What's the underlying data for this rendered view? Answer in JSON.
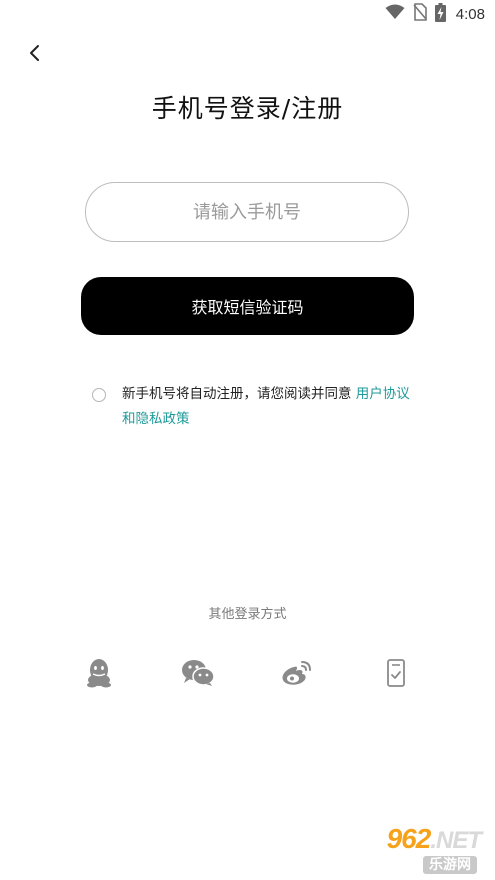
{
  "status_bar": {
    "time": "4:08",
    "icons": [
      "wifi-icon",
      "no-sim-icon",
      "battery-charging-icon"
    ]
  },
  "nav": {
    "back_icon": "chevron-left-icon"
  },
  "page": {
    "title": "手机号登录/注册"
  },
  "form": {
    "phone_placeholder": "请输入手机号",
    "phone_value": "",
    "sms_button_label": "获取短信验证码"
  },
  "agreement": {
    "checked": false,
    "text": "新手机号将自动注册，请您阅读并同意",
    "link_text": "用户协议和隐私政策",
    "link_color": "#1f9a9a"
  },
  "other_login": {
    "label": "其他登录方式",
    "options": [
      {
        "icon": "qq-icon"
      },
      {
        "icon": "wechat-icon"
      },
      {
        "icon": "weibo-icon"
      },
      {
        "icon": "phone-verify-icon"
      }
    ]
  },
  "watermark": {
    "number": "962",
    "suffix": ".NET",
    "tagline": "乐游网"
  },
  "colors": {
    "accent_link": "#1f9a9a",
    "primary_button": "#000000",
    "icon_gray": "#8a8a8a"
  }
}
